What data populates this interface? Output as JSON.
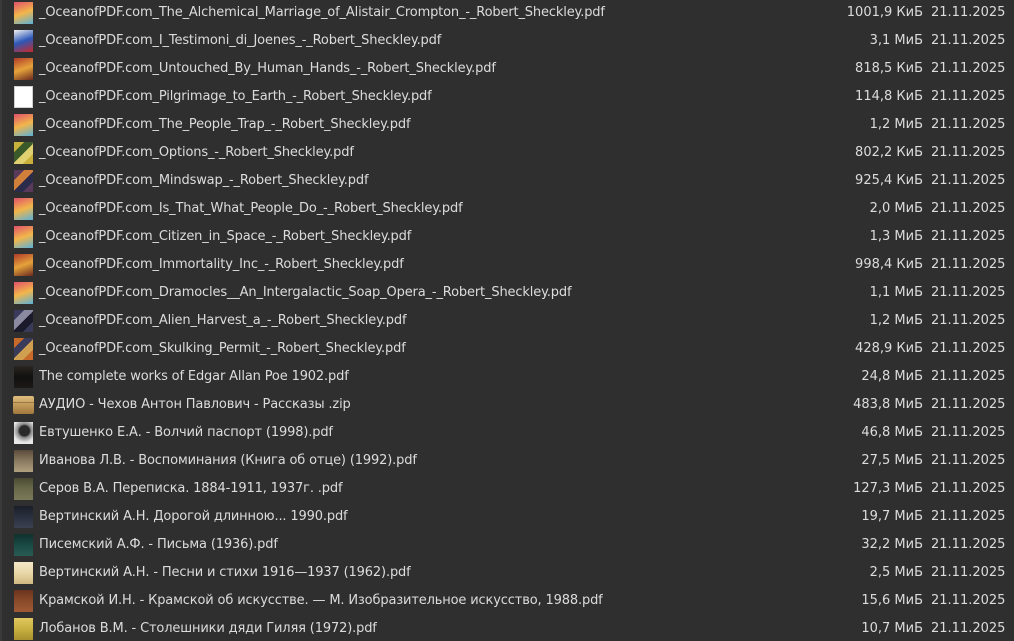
{
  "files": [
    {
      "name": "_OceanofPDF.com_The_Alchemical_Marriage_of_Alistair_Crompton_-_Robert_Sheckley.pdf",
      "size": "1001,9 КиБ",
      "date": "21.11.2025",
      "icon": "rainbow-cover-icon",
      "colors": [
        "#e0506a",
        "#f2b64a",
        "#5ab0d8"
      ]
    },
    {
      "name": "_OceanofPDF.com_I_Testimoni_di_Joenes_-_Robert_Sheckley.pdf",
      "size": "3,1 МиБ",
      "date": "21.11.2025",
      "icon": "blue-white-cover-icon",
      "colors": [
        "#f2f2f2",
        "#2d58b8",
        "#c82a2a"
      ]
    },
    {
      "name": "_OceanofPDF.com_Untouched_By_Human_Hands_-_Robert_Sheckley.pdf",
      "size": "818,5 КиБ",
      "date": "21.11.2025",
      "icon": "red-cover-icon",
      "colors": [
        "#b03a2a",
        "#e6a23a",
        "#6a2a20"
      ]
    },
    {
      "name": "_OceanofPDF.com_Pilgrimage_to_Earth_-_Robert_Sheckley.pdf",
      "size": "114,8 КиБ",
      "date": "21.11.2025",
      "icon": "white-page-icon",
      "colors": [
        "#ffffff",
        "#f4f4f4",
        "#e8e8e8"
      ]
    },
    {
      "name": "_OceanofPDF.com_The_People_Trap_-_Robert_Sheckley.pdf",
      "size": "1,2 МиБ",
      "date": "21.11.2025",
      "icon": "rainbow-cover-icon",
      "colors": [
        "#e0506a",
        "#f2b64a",
        "#5ab0d8"
      ]
    },
    {
      "name": "_OceanofPDF.com_Options_-_Robert_Sheckley.pdf",
      "size": "802,2 КиБ",
      "date": "21.11.2025",
      "icon": "yellow-collage-cover-icon",
      "colors": [
        "#c8b03a",
        "#3a5a2a",
        "#e0d070"
      ]
    },
    {
      "name": "_OceanofPDF.com_Mindswap_-_Robert_Sheckley.pdf",
      "size": "925,4 КиБ",
      "date": "21.11.2025",
      "icon": "dark-collage-cover-icon",
      "colors": [
        "#5a3a5a",
        "#d0803a",
        "#2a2a4a"
      ]
    },
    {
      "name": "_OceanofPDF.com_Is_That_What_People_Do_-_Robert_Sheckley.pdf",
      "size": "2,0 МиБ",
      "date": "21.11.2025",
      "icon": "rainbow-cover-icon",
      "colors": [
        "#e0506a",
        "#f2b64a",
        "#5ab0d8"
      ]
    },
    {
      "name": "_OceanofPDF.com_Citizen_in_Space_-_Robert_Sheckley.pdf",
      "size": "1,3 МиБ",
      "date": "21.11.2025",
      "icon": "rainbow-cover-icon",
      "colors": [
        "#e0506a",
        "#f2b64a",
        "#5ab0d8"
      ]
    },
    {
      "name": "_OceanofPDF.com_Immortality_Inc_-_Robert_Sheckley.pdf",
      "size": "998,4 КиБ",
      "date": "21.11.2025",
      "icon": "red-cover-icon",
      "colors": [
        "#b03a2a",
        "#e6a23a",
        "#6a2a20"
      ]
    },
    {
      "name": "_OceanofPDF.com_Dramocles__An_Intergalactic_Soap_Opera_-_Robert_Sheckley.pdf",
      "size": "1,1 МиБ",
      "date": "21.11.2025",
      "icon": "rainbow-cover-icon",
      "colors": [
        "#e0506a",
        "#f2b64a",
        "#5ab0d8"
      ]
    },
    {
      "name": "_OceanofPDF.com_Alien_Harvest_a_-_Robert_Sheckley.pdf",
      "size": "1,2 МиБ",
      "date": "21.11.2025",
      "icon": "dark-collage-cover-icon",
      "colors": [
        "#3a3a5a",
        "#8a8aa0",
        "#1a1a2a"
      ]
    },
    {
      "name": "_OceanofPDF.com_Skulking_Permit_-_Robert_Sheckley.pdf",
      "size": "428,9 КиБ",
      "date": "21.11.2025",
      "icon": "dark-collage-cover-icon",
      "colors": [
        "#c86a2a",
        "#3a3a5a",
        "#d0a050"
      ]
    },
    {
      "name": "The complete works of Edgar Allan Poe 1902.pdf",
      "size": "24,8 МиБ",
      "date": "21.11.2025",
      "icon": "black-cover-icon",
      "colors": [
        "#101010",
        "#1c1a16",
        "#2a2620"
      ]
    },
    {
      "name": "АУДИО -  Чехов Антон Павлович - Рассказы .zip",
      "size": "483,8 МиБ",
      "date": "21.11.2025",
      "icon": "archive-icon",
      "colors": [
        "#c8a060",
        "#a0783c",
        "#e0c080"
      ]
    },
    {
      "name": "Евтушенко Е.А. - Волчий паспорт (1998).pdf",
      "size": "46,8 МиБ",
      "date": "21.11.2025",
      "icon": "portrait-cover-icon",
      "colors": [
        "#e8e8e8",
        "#2a2a2a",
        "#8a8a8a"
      ]
    },
    {
      "name": "Иванова Л.В. - Воспоминания (Книга об отце) (1992).pdf",
      "size": "27,5 МиБ",
      "date": "21.11.2025",
      "icon": "beige-cover-icon",
      "colors": [
        "#8a7a60",
        "#b0a080",
        "#5a4a3a"
      ]
    },
    {
      "name": "Серов В.А. Переписка. 1884-1911, 1937г. .pdf",
      "size": "127,3 МиБ",
      "date": "21.11.2025",
      "icon": "olive-cover-icon",
      "colors": [
        "#6a6a4a",
        "#7a7a5a",
        "#4a4a34"
      ]
    },
    {
      "name": "Вертинский А.Н. Дорогой длинною... 1990.pdf",
      "size": "19,7 МиБ",
      "date": "21.11.2025",
      "icon": "dark-blue-cover-icon",
      "colors": [
        "#2a3040",
        "#3a4050",
        "#1a1e28"
      ]
    },
    {
      "name": "Писемский А.Ф. - Письма (1936).pdf",
      "size": "32,2 МиБ",
      "date": "21.11.2025",
      "icon": "teal-cover-icon",
      "colors": [
        "#1a4a44",
        "#2a5a54",
        "#10302c"
      ]
    },
    {
      "name": "Вертинский А.Н. - Песни и стихи 1916—1937 (1962).pdf",
      "size": "2,5 МиБ",
      "date": "21.11.2025",
      "icon": "cream-cover-icon",
      "colors": [
        "#e8d8a8",
        "#d0b880",
        "#f4e8c8"
      ]
    },
    {
      "name": "Крамской И.Н. - Крамской об искусстве. — М. Изобразительное искусство, 1988.pdf",
      "size": "15,6 МиБ",
      "date": "21.11.2025",
      "icon": "brown-cover-icon",
      "colors": [
        "#8a4a2a",
        "#a05a34",
        "#6a341c"
      ]
    },
    {
      "name": "Лобанов В.М. - Столешники дяди Гиляя (1972).pdf",
      "size": "10,7 МиБ",
      "date": "21.11.2025",
      "icon": "yellow-cover-icon",
      "colors": [
        "#c8b040",
        "#a89030",
        "#e0c860"
      ]
    }
  ]
}
